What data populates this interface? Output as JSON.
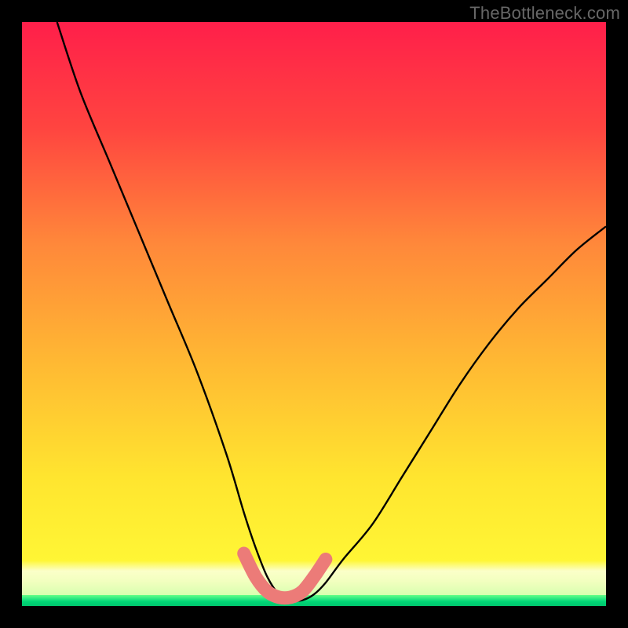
{
  "watermark": "TheBottleneck.com",
  "colors": {
    "background": "#000000",
    "gradient_top": "#ff1f4a",
    "gradient_mid1": "#ff7a3a",
    "gradient_mid2": "#ffd22e",
    "gradient_bottom": "#ffff36",
    "green_strip": "#00d676",
    "curve": "#000000",
    "valley_mark": "#ec7b78",
    "watermark": "#676767"
  },
  "chart_data": {
    "type": "line",
    "title": "",
    "xlabel": "",
    "ylabel": "",
    "xlim": [
      0,
      100
    ],
    "ylim": [
      0,
      100
    ],
    "grid": false,
    "series": [
      {
        "name": "bottleneck-curve",
        "x": [
          6,
          10,
          15,
          20,
          25,
          30,
          35,
          38,
          40,
          42,
          44,
          46,
          48,
          50,
          52,
          55,
          60,
          65,
          70,
          75,
          80,
          85,
          90,
          95,
          100
        ],
        "y": [
          100,
          88,
          76,
          64,
          52,
          40,
          26,
          16,
          10,
          5,
          2,
          1,
          1,
          2,
          4,
          8,
          14,
          22,
          30,
          38,
          45,
          51,
          56,
          61,
          65
        ]
      }
    ],
    "annotations": [
      {
        "name": "valley-highlight",
        "kind": "segment",
        "x": [
          38,
          40,
          42,
          44,
          46,
          48,
          50,
          52
        ],
        "y": [
          9,
          5,
          2.5,
          1.5,
          1.5,
          2.5,
          5,
          8
        ],
        "color": "#ec7b78"
      }
    ]
  }
}
